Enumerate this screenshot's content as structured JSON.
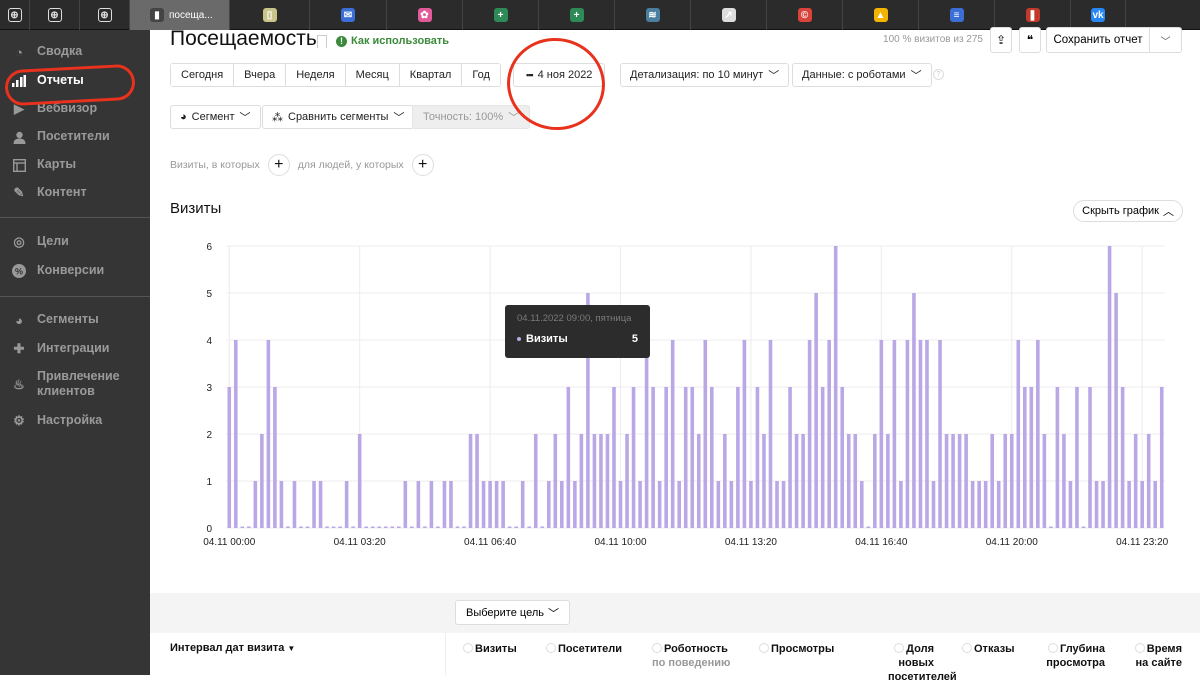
{
  "browser_tabs": [
    {
      "icon": "plus-circle-icon",
      "label": "",
      "color": "#2b2b2b"
    },
    {
      "icon": "plus-circle-icon",
      "label": "",
      "color": "#2b2b2b"
    },
    {
      "icon": "plus-circle-icon",
      "label": "",
      "color": "#2b2b2b"
    },
    {
      "icon": "metrica-icon",
      "label": "посеща...",
      "color": "#444444",
      "active": true
    },
    {
      "icon": "book-icon",
      "label": "",
      "color": "#c9c48a"
    },
    {
      "icon": "mail-icon",
      "label": "",
      "color": "#3b6fd6"
    },
    {
      "icon": "photos-icon",
      "label": "",
      "color": "#e25a9a"
    },
    {
      "icon": "sheets-icon",
      "label": "",
      "color": "#2e8b57"
    },
    {
      "icon": "sheets-icon",
      "label": "",
      "color": "#2e8b57"
    },
    {
      "icon": "db-icon",
      "label": "",
      "color": "#4a7fa0"
    },
    {
      "icon": "chart-icon",
      "label": "",
      "color": "#dddddd"
    },
    {
      "icon": "copyright-icon",
      "label": "",
      "color": "#d9443a"
    },
    {
      "icon": "drive-icon",
      "label": "",
      "color": "#f3b400"
    },
    {
      "icon": "docs-icon",
      "label": "",
      "color": "#3b6fd6"
    },
    {
      "icon": "bars-icon",
      "label": "",
      "color": "#c0392b"
    },
    {
      "icon": "vk-icon",
      "label": "",
      "color": "#2787f5"
    }
  ],
  "sidebar": {
    "items": [
      {
        "label": "Сводка",
        "icon": "gauge-icon"
      },
      {
        "label": "Отчеты",
        "icon": "bar-chart-icon",
        "active": true
      },
      {
        "label": "Вебвизор",
        "icon": "play-icon"
      },
      {
        "label": "Посетители",
        "icon": "person-icon"
      },
      {
        "label": "Карты",
        "icon": "map-layout-icon"
      },
      {
        "label": "Контент",
        "icon": "pencil-icon"
      },
      {
        "label": "Цели",
        "icon": "target-icon"
      },
      {
        "label": "Конверсии",
        "icon": "percent-icon"
      },
      {
        "label": "Сегменты",
        "icon": "pie-icon"
      },
      {
        "label": "Интеграции",
        "icon": "puzzle-icon"
      },
      {
        "label": "Привлечение клиентов",
        "icon": "flame-icon"
      },
      {
        "label": "Настройка",
        "icon": "gear-icon"
      }
    ]
  },
  "header": {
    "title": "Посещаемость",
    "howto": "Как использовать",
    "sample_note": "100 % визитов из 275",
    "save_report": "Сохранить отчет"
  },
  "periods": [
    "Сегодня",
    "Вчера",
    "Неделя",
    "Месяц",
    "Квартал",
    "Год"
  ],
  "date_picker": "4 ноя 2022",
  "detail": "Детализация: по 10 минут",
  "data_mode": "Данные: с роботами",
  "segment": "Сегмент",
  "compare": "Сравнить сегменты",
  "accuracy": "Точность: 100%",
  "filter": {
    "visits_label": "Визиты, в которых",
    "people_label": "для людей, у которых"
  },
  "section_title": "Визиты",
  "hide_chart": "Скрыть график",
  "tooltip": {
    "date": "04.11.2022 09:00, пятница",
    "series": "Визиты",
    "value": "5"
  },
  "table": {
    "goal_button": "Выберите цель",
    "dimension": "Интервал дат визита",
    "columns": [
      {
        "label": "Визиты",
        "sub": ""
      },
      {
        "label": "Посетители",
        "sub": ""
      },
      {
        "label": "Роботность",
        "sub": "по поведению"
      },
      {
        "label": "Просмотры",
        "sub": ""
      },
      {
        "label": "Доля новых посетителей",
        "sub": ""
      },
      {
        "label": "Отказы",
        "sub": ""
      },
      {
        "label": "Глубина просмотра",
        "sub": ""
      },
      {
        "label": "Время на сайте",
        "sub": ""
      }
    ]
  },
  "colors": {
    "bar": "#b9a7e6",
    "sidebar_bg": "#353535",
    "accent_green": "#3b8a3b",
    "annotation_red": "#e8321e"
  },
  "chart_data": {
    "type": "bar",
    "title": "Визиты",
    "xlabel": "",
    "ylabel": "",
    "ylim": [
      0,
      6
    ],
    "yticks": [
      "0",
      "1",
      "2",
      "3",
      "4",
      "5",
      "6"
    ],
    "xtick_labels": [
      "04.11 00:00",
      "04.11 03:20",
      "04.11 06:40",
      "04.11 10:00",
      "04.11 13:20",
      "04.11 16:40",
      "04.11 20:00",
      "04.11 23:20"
    ],
    "xtick_every": 20,
    "interval": "10 minutes",
    "grid": true,
    "series": [
      {
        "name": "Визиты",
        "values": [
          3,
          4,
          0,
          0,
          1,
          2,
          4,
          3,
          1,
          0,
          1,
          0,
          0,
          1,
          1,
          0,
          0,
          0,
          1,
          0,
          2,
          0,
          0,
          0,
          0,
          0,
          0,
          1,
          0,
          1,
          0,
          1,
          0,
          1,
          1,
          0,
          0,
          2,
          2,
          1,
          1,
          1,
          1,
          0,
          0,
          1,
          0,
          2,
          0,
          1,
          2,
          1,
          3,
          1,
          2,
          5,
          2,
          2,
          2,
          3,
          1,
          2,
          3,
          1,
          4,
          3,
          1,
          3,
          4,
          1,
          3,
          3,
          2,
          4,
          3,
          1,
          2,
          1,
          3,
          4,
          1,
          3,
          2,
          4,
          1,
          1,
          3,
          2,
          2,
          4,
          5,
          3,
          4,
          6,
          3,
          2,
          2,
          1,
          0,
          2,
          4,
          2,
          4,
          1,
          4,
          5,
          4,
          4,
          1,
          4,
          2,
          2,
          2,
          2,
          1,
          1,
          1,
          2,
          1,
          2,
          2,
          4,
          3,
          3,
          4,
          2,
          0,
          3,
          2,
          1,
          3,
          0,
          3,
          1,
          1,
          6,
          5,
          3,
          1,
          2,
          1,
          2,
          1,
          3
        ]
      }
    ]
  }
}
